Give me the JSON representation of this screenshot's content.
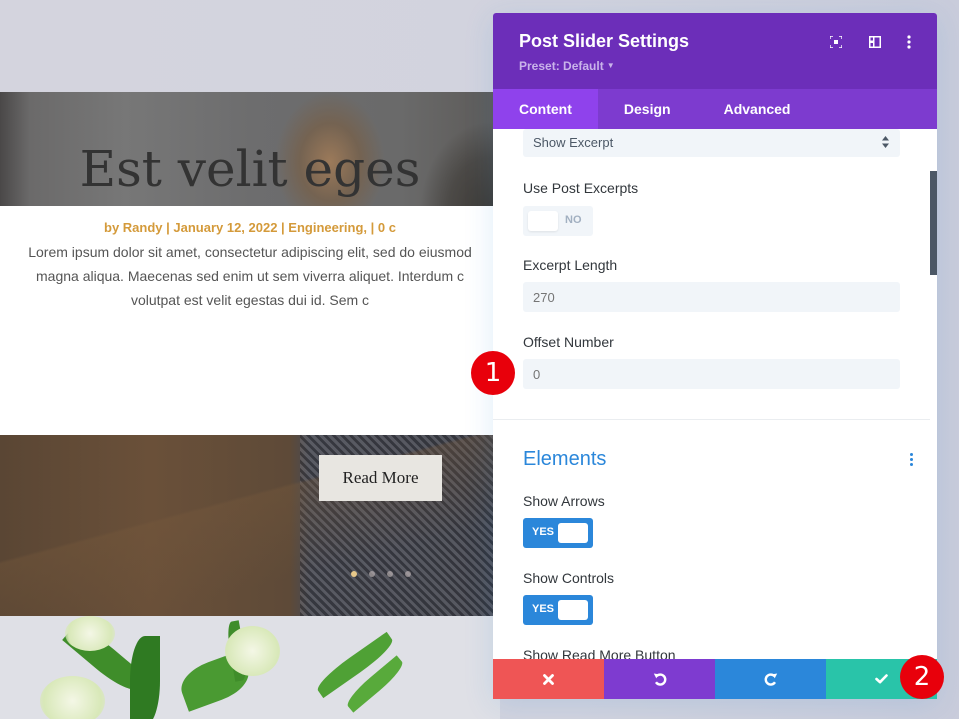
{
  "background_page": {
    "post": {
      "title": "Est velit eges",
      "meta": "by Randy | January 12, 2022 | Engineering, | 0 c",
      "excerpt_lines": [
        "Lorem ipsum dolor sit amet, consectetur adipiscing elit, sed do eiusmod",
        "magna aliqua. Maecenas sed enim ut sem viverra aliquet. Interdum c",
        "volutpat est velit egestas dui id. Sem c"
      ],
      "read_more_label": "Read More"
    },
    "slider": {
      "dot_count": 4,
      "active_dot": 1
    }
  },
  "modal": {
    "title": "Post Slider Settings",
    "preset_label": "Preset: Default",
    "header_icons": [
      "fullscreen-icon",
      "split-view-icon",
      "more-options-icon"
    ],
    "tabs": [
      {
        "label": "Content",
        "active": true
      },
      {
        "label": "Design",
        "active": false
      },
      {
        "label": "Advanced",
        "active": false
      }
    ],
    "fields": {
      "content_display": {
        "value": "Show Excerpt"
      },
      "use_post_excerpts": {
        "label": "Use Post Excerpts",
        "value": false,
        "state_label": "NO"
      },
      "excerpt_length": {
        "label": "Excerpt Length",
        "placeholder": "270",
        "value": ""
      },
      "offset_number": {
        "label": "Offset Number",
        "placeholder": "0",
        "value": ""
      }
    },
    "elements_section": {
      "title": "Elements",
      "show_arrows": {
        "label": "Show Arrows",
        "value": true,
        "state_label": "YES"
      },
      "show_controls": {
        "label": "Show Controls",
        "value": true,
        "state_label": "YES"
      },
      "show_read_more": {
        "label": "Show Read More Button"
      }
    },
    "footer_buttons": [
      {
        "name": "cancel",
        "icon": "close-icon",
        "color": "#ef5555"
      },
      {
        "name": "undo",
        "icon": "undo-icon",
        "color": "#7e3bd0"
      },
      {
        "name": "redo",
        "icon": "redo-icon",
        "color": "#2b87da"
      },
      {
        "name": "save",
        "icon": "check-icon",
        "color": "#29c4a9"
      }
    ]
  },
  "annotations": [
    {
      "label": "1"
    },
    {
      "label": "2"
    }
  ],
  "colors": {
    "header_purple": "#6c2eb9",
    "tab_bar": "#7d3bcf",
    "tab_active": "#8f42ec",
    "accent_blue": "#2b87da",
    "meta_orange": "#d49a3a",
    "badge_red": "#e8000b"
  }
}
